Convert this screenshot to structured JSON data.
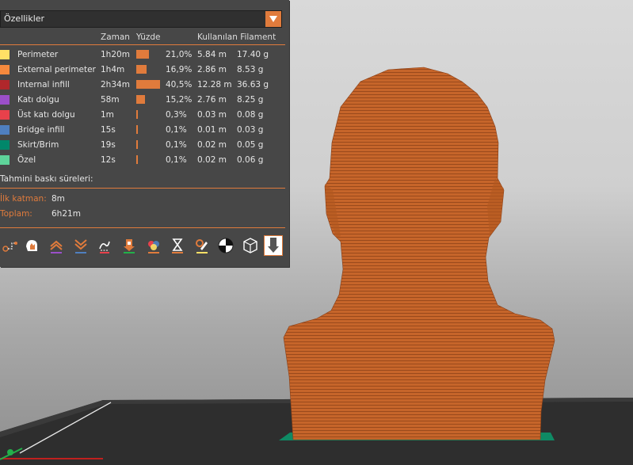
{
  "panel": {
    "dropdown_value": "Özellikler",
    "headers": {
      "time": "Zaman",
      "percent": "Yüzde",
      "used_filament": "Kullanılan Filament"
    },
    "rows": [
      {
        "label": "Perimeter",
        "color": "#ffe066",
        "time": "1h20m",
        "percent": "21,0%",
        "share": 0.21,
        "length": "5.84 m",
        "weight": "17.40 g"
      },
      {
        "label": "External perimeter",
        "color": "#f5893d",
        "time": "1h4m",
        "percent": "16,9%",
        "share": 0.169,
        "length": "2.86 m",
        "weight": "8.53 g"
      },
      {
        "label": "Internal infill",
        "color": "#b0272b",
        "time": "2h34m",
        "percent": "40,5%",
        "share": 0.405,
        "length": "12.28 m",
        "weight": "36.63 g"
      },
      {
        "label": "Katı dolgu",
        "color": "#9b4fc9",
        "time": "58m",
        "percent": "15,2%",
        "share": 0.152,
        "length": "2.76 m",
        "weight": "8.25 g"
      },
      {
        "label": "Üst katı dolgu",
        "color": "#e8414b",
        "time": "1m",
        "percent": "0,3%",
        "share": 0.003,
        "length": "0.03 m",
        "weight": "0.08 g"
      },
      {
        "label": "Bridge infill",
        "color": "#4f7fc0",
        "time": "15s",
        "percent": "0,1%",
        "share": 0.001,
        "length": "0.01 m",
        "weight": "0.03 g"
      },
      {
        "label": "Skirt/Brim",
        "color": "#00876a",
        "time": "19s",
        "percent": "0,1%",
        "share": 0.001,
        "length": "0.02 m",
        "weight": "0.05 g"
      },
      {
        "label": "Özel",
        "color": "#5ed49a",
        "time": "12s",
        "percent": "0,1%",
        "share": 0.001,
        "length": "0.02 m",
        "weight": "0.06 g"
      }
    ],
    "estimate": {
      "title": "Tahmini baskı süreleri:",
      "first_layer_label": "İlk katman:",
      "first_layer_value": "8m",
      "total_label": "Toplam:",
      "total_value": "6h21m"
    }
  },
  "toolbar_icons": [
    "travel-icon",
    "wipe-icon",
    "retractions-icon",
    "deretractions-icon",
    "seams-icon",
    "tool-changes-icon",
    "color-changes-icon",
    "pause-icon",
    "custom-gcode-icon",
    "center-of-gravity-icon",
    "shells-icon",
    "tool-marker-icon"
  ],
  "colors": {
    "accent": "#e07b3c",
    "panel_bg": "#474747",
    "model": "#c8662a"
  }
}
